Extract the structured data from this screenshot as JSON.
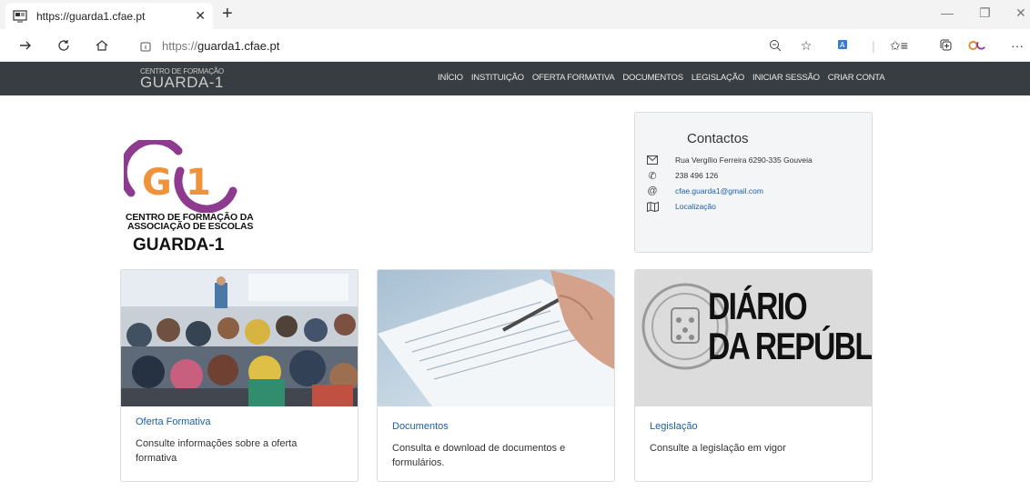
{
  "browser": {
    "tab_title": "https://guarda1.cfae.pt",
    "url_prefix": "https://",
    "url_host": "guarda1.cfae.pt"
  },
  "site": {
    "brand_small": "CENTRO DE FORMAÇÃO",
    "brand_big": "GUARDA-1",
    "menu": [
      "INÍCIO",
      "INSTITUIÇÃO",
      "OFERTA FORMATIVA",
      "DOCUMENTOS",
      "LEGISLAÇÃO",
      "INICIAR SESSÃO",
      "CRIAR CONTA"
    ]
  },
  "logo": {
    "mark_g": "G",
    "mark_1": "1",
    "line1": "CENTRO DE FORMAÇÃO DA",
    "line2": "ASSOCIAÇÃO DE ESCOLAS",
    "line3": "GUARDA-1",
    "colors": {
      "orange": "#f0923b",
      "purple": "#8e3a8f"
    }
  },
  "contacts": {
    "title": "Contactos",
    "address": "Rua Vergílio Ferreira 6290-335 Gouveia",
    "phone": "238 496 126",
    "email": "cfae.guarda1@gmail.com",
    "location": "Localização"
  },
  "cards": [
    {
      "title": "Oferta Formativa",
      "desc": "Consulte informações sobre a oferta formativa"
    },
    {
      "title": "Documentos",
      "desc": "Consulta e download de documentos e formulários."
    },
    {
      "title": "Legislação",
      "desc": "Consulte a legislação em vigor",
      "img_line1": "DIÁRIO",
      "img_line2": "DA REPÚBLICA"
    }
  ],
  "colors": {
    "navbar": "#383d41",
    "link": "#1a5fa8"
  }
}
